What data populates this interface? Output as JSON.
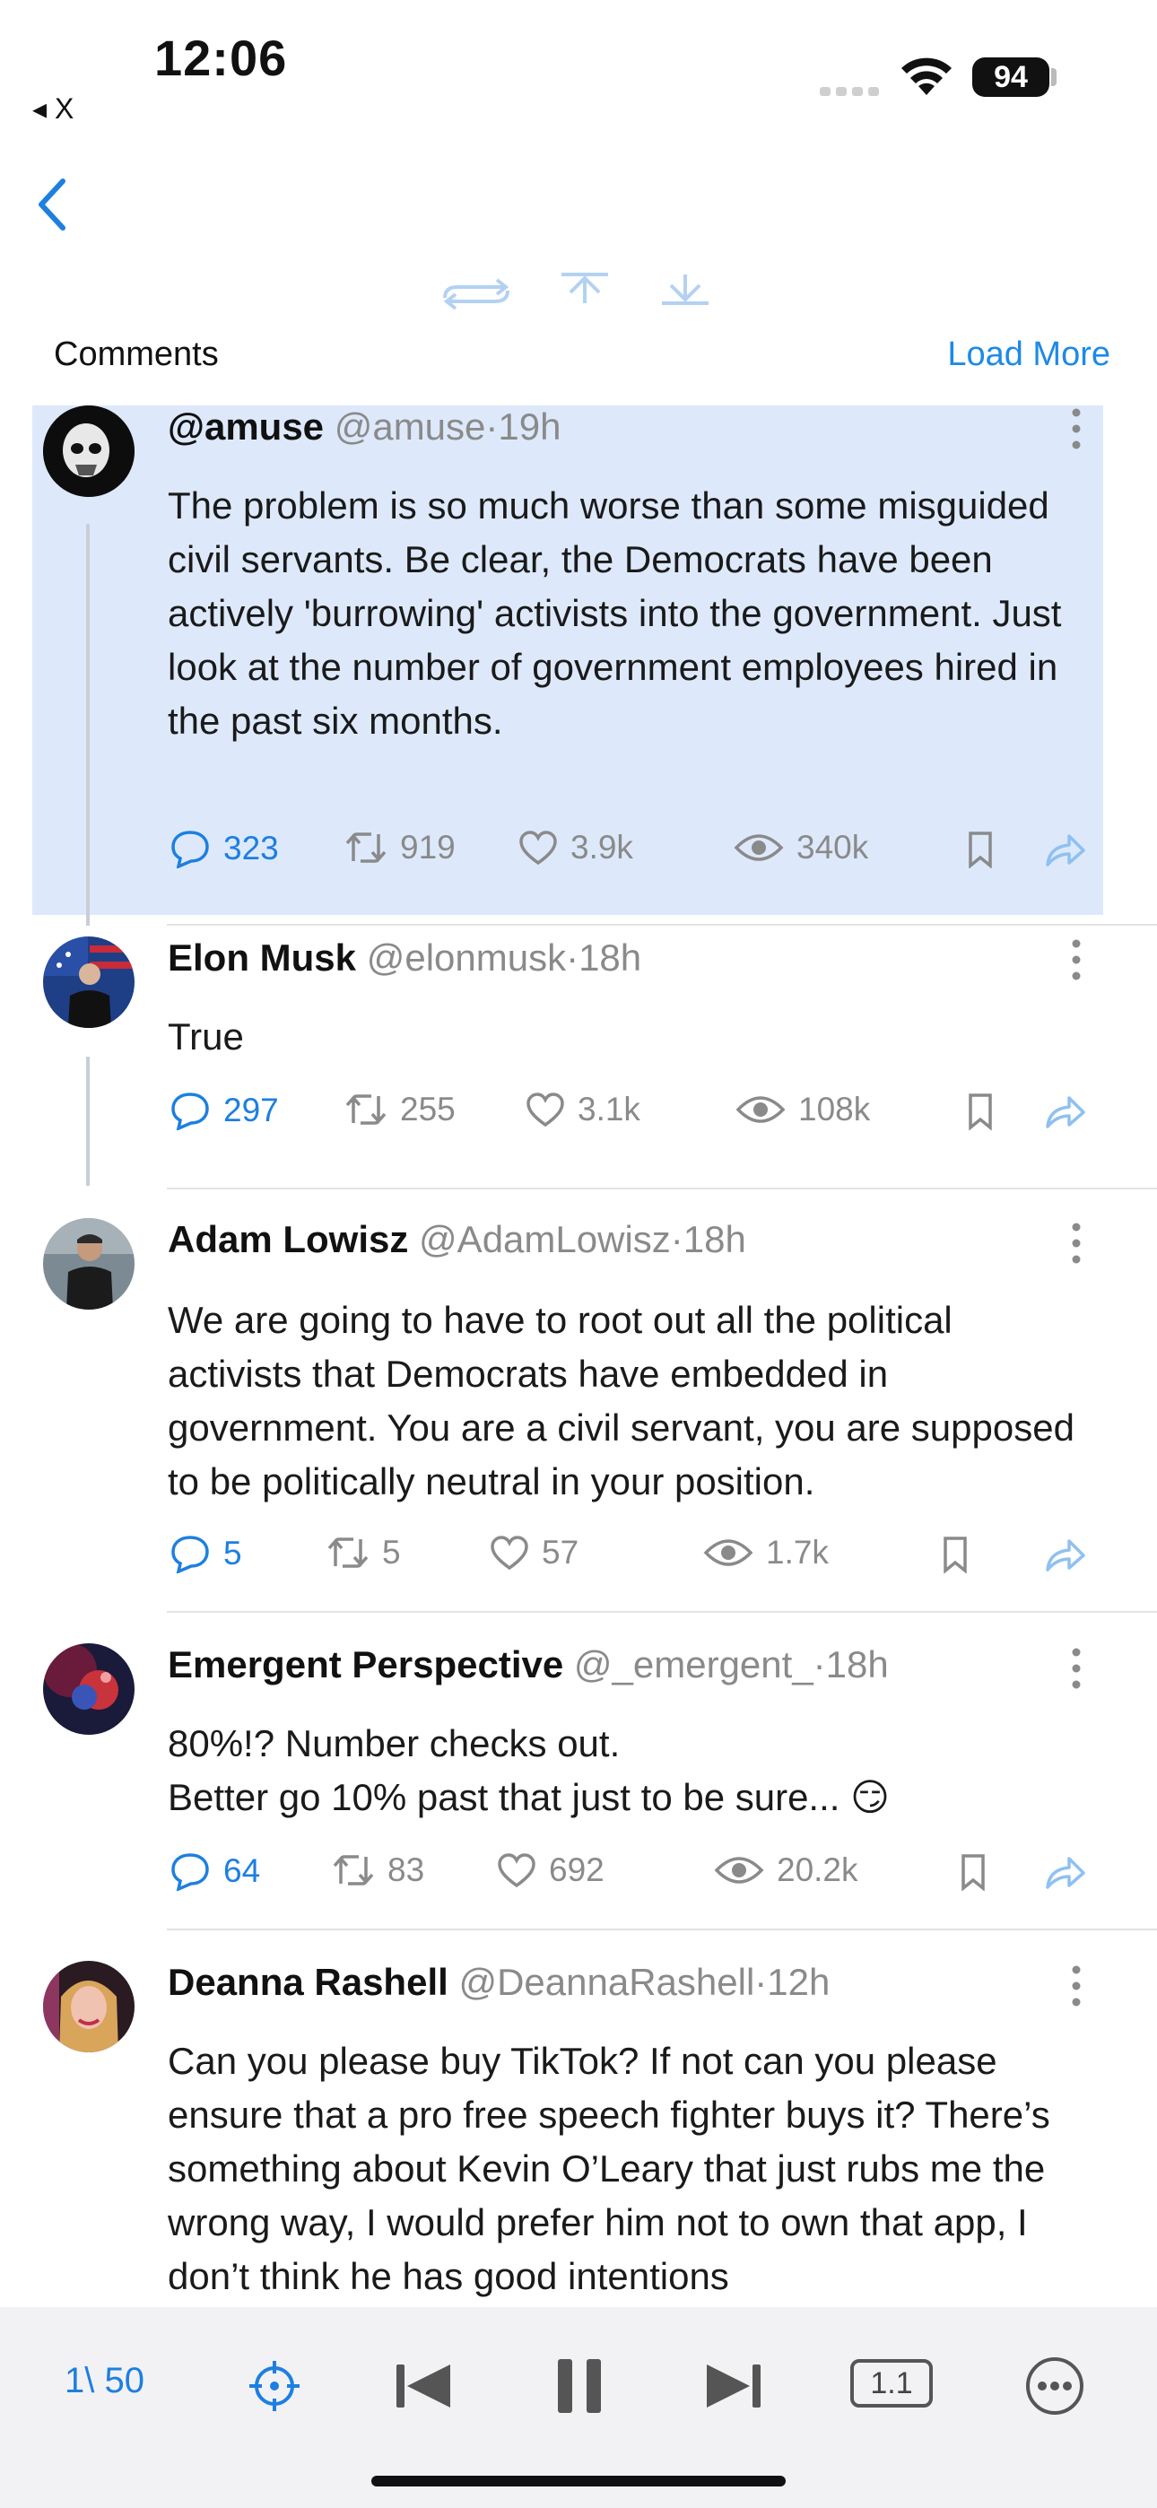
{
  "status_bar": {
    "time": "12:06",
    "back_app": "◂ X",
    "battery": "94"
  },
  "header": {
    "comments_label": "Comments",
    "load_more_label": "Load More"
  },
  "comments": [
    {
      "name": "@amuse",
      "handle": "@amuse·19h",
      "text": "The problem is so much worse than some misguided civil servants. Be clear, the Democrats have been actively 'burrowing' activists into the government. Just look at the number of government employees hired in the past six months.",
      "replies": "323",
      "reposts": "919",
      "likes": "3.9k",
      "views": "340k"
    },
    {
      "name": "Elon Musk",
      "handle": "@elonmusk·18h",
      "text": "True",
      "replies": "297",
      "reposts": "255",
      "likes": "3.1k",
      "views": "108k"
    },
    {
      "name": "Adam Lowisz",
      "handle": "@AdamLowisz·18h",
      "text": "We are going to have to root out all the political activists that Democrats have embedded in government. You are a civil servant, you are supposed to be politically neutral in your position.",
      "replies": "5",
      "reposts": "5",
      "likes": "57",
      "views": "1.7k"
    },
    {
      "name": "Emergent Perspective",
      "handle": "@_emergent_·18h",
      "text_line1": "80%!? Number checks out.",
      "text_line2": "Better go 10% past that just to be sure... 😏",
      "replies": "64",
      "reposts": "83",
      "likes": "692",
      "views": "20.2k"
    },
    {
      "name": "Deanna Rashell",
      "handle": "@DeannaRashell·12h",
      "text": "Can you please buy TikTok? If not can you please ensure that a pro free speech fighter buys it? There’s something about Kevin O’Leary that just rubs me the wrong way, I would prefer him not to own that app, I don’t think he has good intentions"
    }
  ],
  "bottom_bar": {
    "page_counter": "1\\ 50",
    "speed": "1.1"
  },
  "colors": {
    "accent": "#1d7fe0",
    "highlight": "#dde9fb",
    "muted": "#8a8a8a"
  },
  "icons": [
    "back-chevron-icon",
    "repost-icon",
    "scroll-top-icon",
    "scroll-bottom-icon",
    "reply-icon",
    "like-icon",
    "views-icon",
    "bookmark-icon",
    "share-icon",
    "more-vertical-icon",
    "target-icon",
    "previous-icon",
    "pause-icon",
    "next-icon",
    "more-horizontal-icon"
  ]
}
